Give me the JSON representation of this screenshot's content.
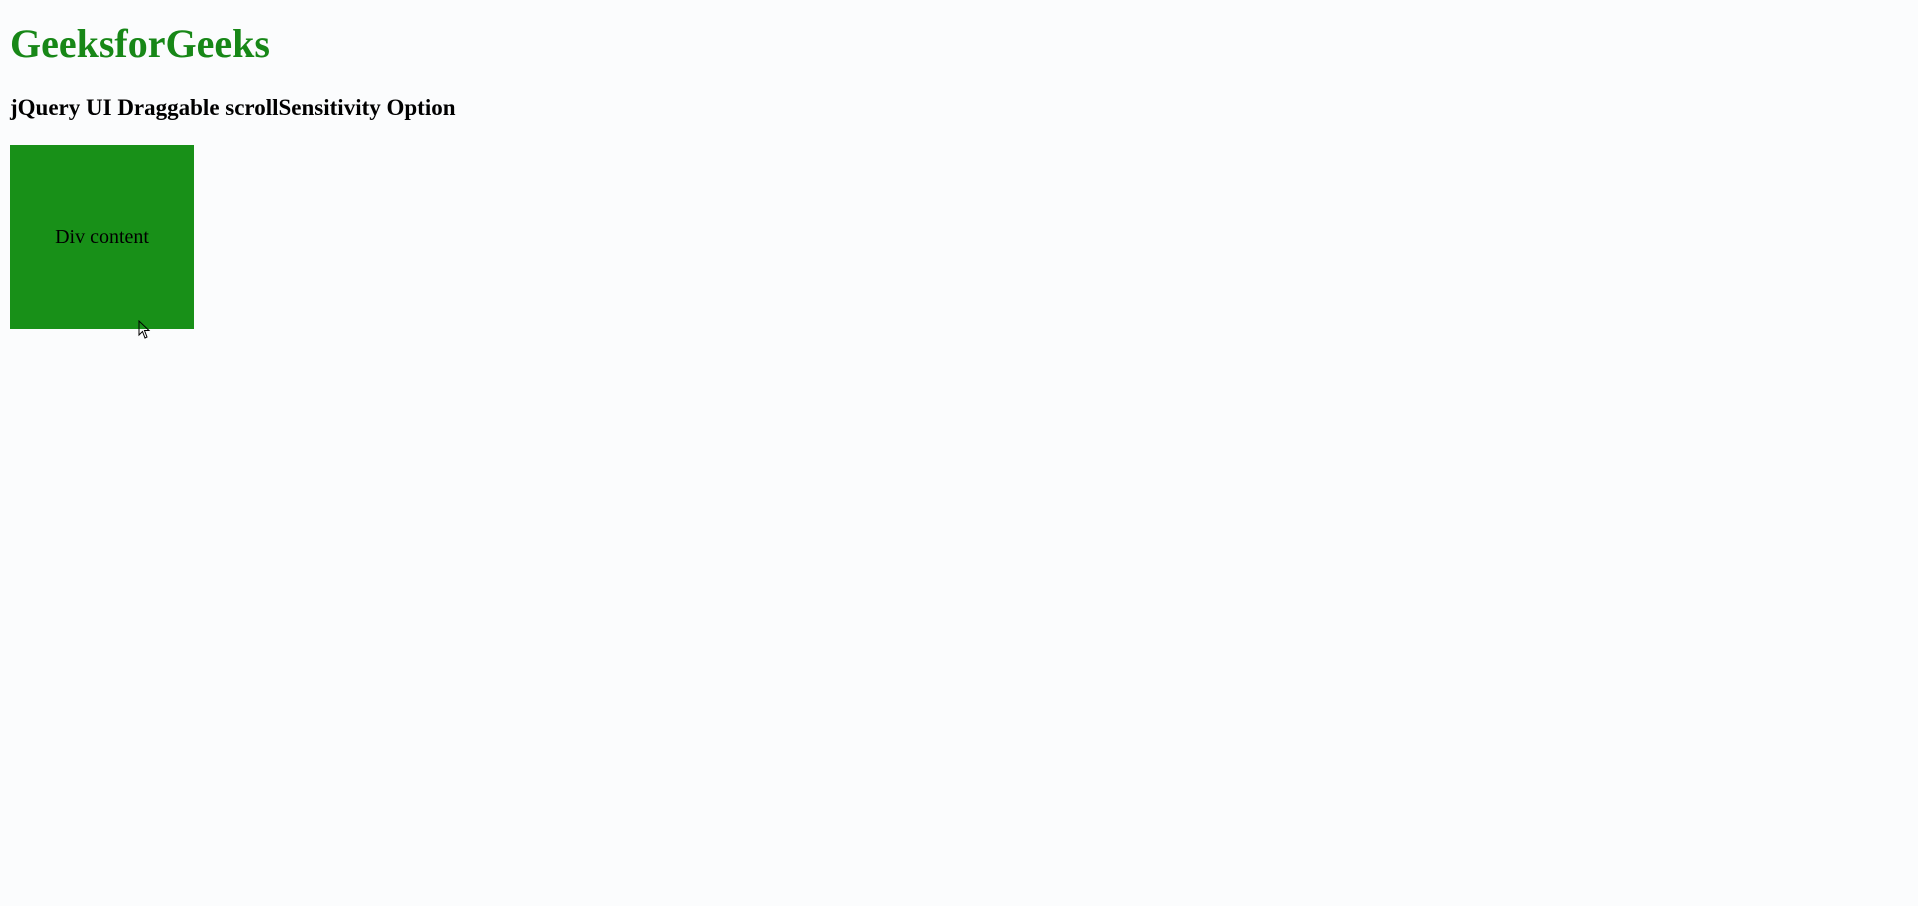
{
  "header": {
    "title": "GeeksforGeeks",
    "subtitle": "jQuery UI Draggable scrollSensitivity Option"
  },
  "draggable": {
    "content": "Div content"
  },
  "colors": {
    "title_color": "#178717",
    "box_color": "#189018",
    "background": "#fbfcfd"
  }
}
